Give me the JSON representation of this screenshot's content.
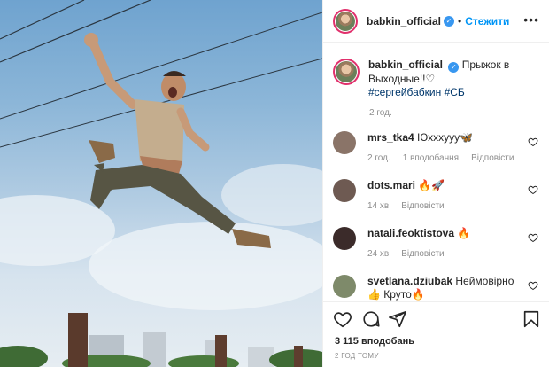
{
  "post": {
    "image_alt": "photo-jumping-man",
    "author": "babkin_official",
    "verified": true,
    "follow_label": "Стежити",
    "more_icon": "more-horizontal-icon"
  },
  "caption": {
    "author": "babkin_official",
    "text": "Прыжок в Выходные!!♡",
    "hashtags": "#сергейбабкин #СБ",
    "time": "2 год."
  },
  "comments": [
    {
      "user": "mrs_tka4",
      "text": "Юхххууу🦋",
      "time": "2 год.",
      "likes": "1 вподобання",
      "reply": "Відповісти",
      "avatar_color": "#8a7468"
    },
    {
      "user": "dots.mari",
      "text": "🔥🚀",
      "time": "14 хв",
      "likes": "",
      "reply": "Відповісти",
      "avatar_color": "#6e5a52"
    },
    {
      "user": "natali.feoktistova",
      "text": "🔥",
      "time": "24 хв",
      "likes": "",
      "reply": "Відповісти",
      "avatar_color": "#3b2b2a"
    },
    {
      "user": "svetlana.dziubak",
      "text": "Неймовірно👍 Круто🔥",
      "time": "",
      "likes": "",
      "reply": "",
      "avatar_color": "#7e8a6a"
    }
  ],
  "stats": {
    "likes": "3 115 вподобань",
    "posted": "2 ГОД ТОМУ"
  },
  "icons": {
    "like": "heart-icon",
    "comment": "comment-icon",
    "share": "share-icon",
    "save": "bookmark-icon"
  },
  "colors": {
    "link": "#0095f6",
    "hashtag": "#00376b",
    "muted": "#8e8e8e",
    "verified": "#3897f0"
  }
}
